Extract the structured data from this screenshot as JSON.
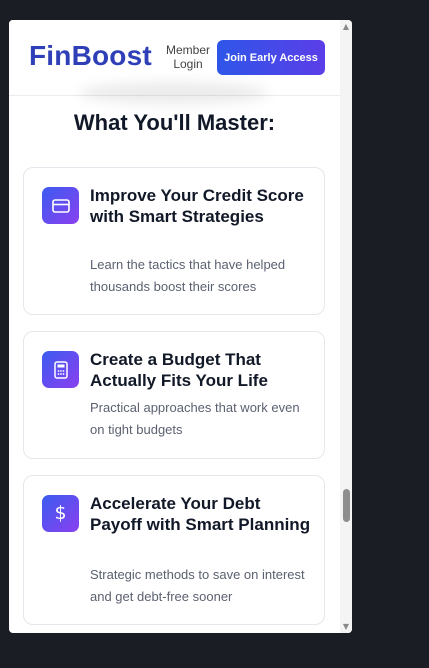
{
  "header": {
    "logo_text": "FinBoost",
    "member_login_line1": "Member",
    "member_login_line2": "Login",
    "cta_label": "Join Early Access"
  },
  "section": {
    "title": "What You'll Master:"
  },
  "cards": [
    {
      "icon": "credit-card-icon",
      "title": "Improve Your Credit Score with Smart Strategies",
      "description": "Learn the tactics that have helped thousands boost their scores"
    },
    {
      "icon": "calculator-icon",
      "title": "Create a Budget That Actually Fits Your Life",
      "description": "Practical approaches that work even on tight budgets"
    },
    {
      "icon": "dollar-icon",
      "title": "Accelerate Your Debt Payoff with Smart Planning",
      "description": "Strategic methods to save on interest and get debt-free sooner"
    }
  ],
  "colors": {
    "brand": "#2e3fb8",
    "cta_start": "#2f56e8",
    "cta_end": "#5b3ee8",
    "icon_start": "#3b5cf0",
    "icon_end": "#8b3ff0",
    "background": "#1b1d24"
  }
}
